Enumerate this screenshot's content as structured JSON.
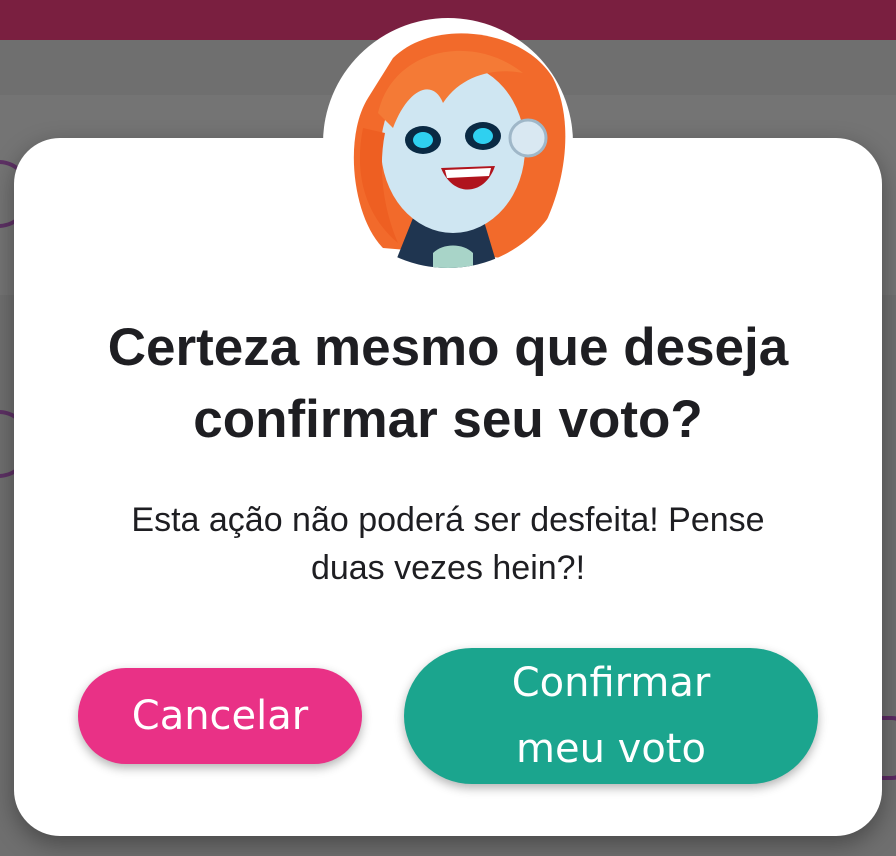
{
  "dialog": {
    "title_line1": "Certeza mesmo que deseja",
    "title_line2": "confirmar seu voto?",
    "message_line1": "Esta ação não poderá ser desfeita! Pense",
    "message_line2": "duas vezes hein?!",
    "cancel_label": "Cancelar",
    "confirm_label_line1": "Confirmar",
    "confirm_label_line2": "meu voto",
    "avatar_icon": "robot-girl-avatar-icon"
  },
  "colors": {
    "topbar": "#7a1f40",
    "cancel_button": "#e93186",
    "confirm_button": "#1ba58e",
    "title_text": "#1e1e22"
  }
}
